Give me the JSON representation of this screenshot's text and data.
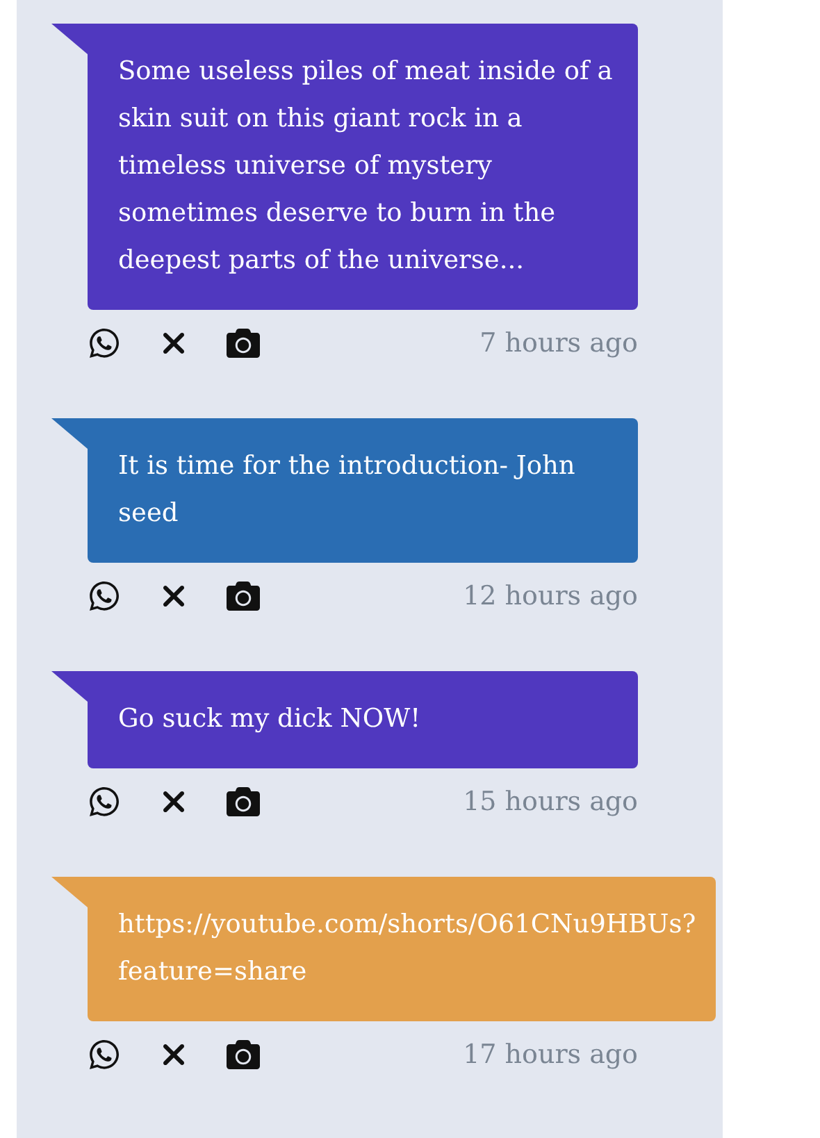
{
  "messages": [
    {
      "text": "Some useless piles of meat inside of a skin suit on this giant rock in a timeless universe of mystery sometimes deserve to burn in the deepest parts of the universe...",
      "color": "#5038bf",
      "time": "7 hours ago"
    },
    {
      "text": "It is time for the introduction- John seed",
      "color": "#2a6db3",
      "time": "12 hours ago"
    },
    {
      "text": "Go suck my dick NOW!",
      "color": "#5038bf",
      "time": "15 hours ago"
    },
    {
      "text": "https://youtube.com/shorts/O61CNu9HBUs?feature=share",
      "color": "#e3a04c",
      "time": "17 hours ago"
    }
  ]
}
